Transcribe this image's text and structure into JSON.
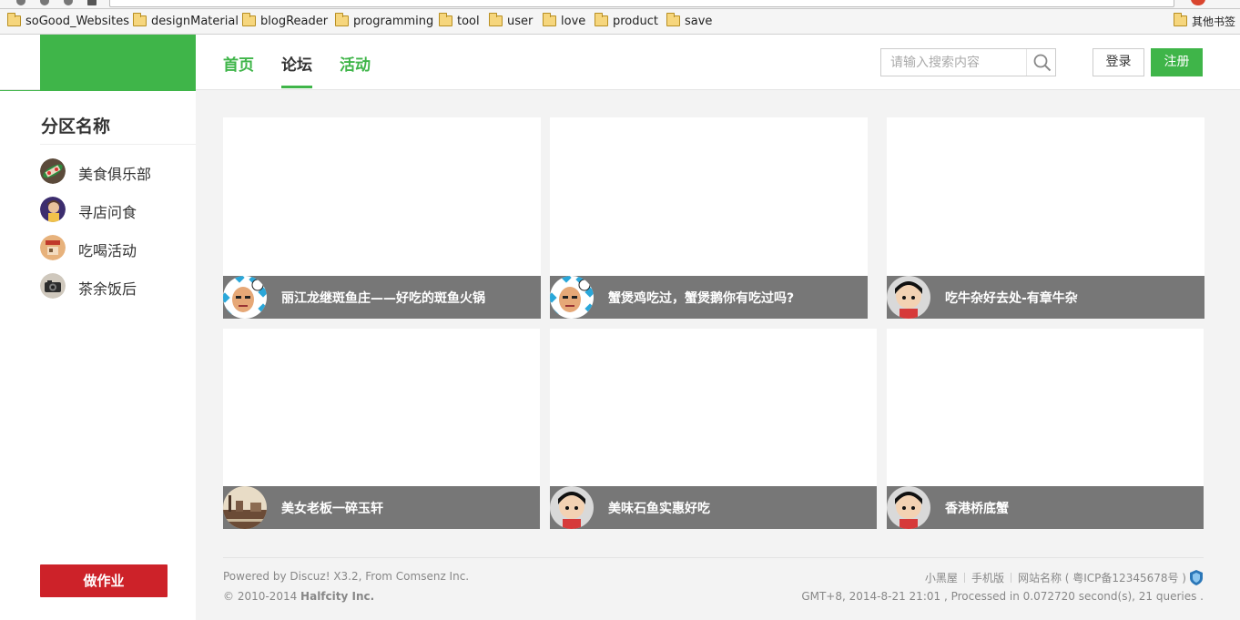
{
  "bookmarks": [
    {
      "label": "soGood_Websites"
    },
    {
      "label": "designMaterial"
    },
    {
      "label": "blogReader"
    },
    {
      "label": "programming"
    },
    {
      "label": "tool"
    },
    {
      "label": "user"
    },
    {
      "label": "love"
    },
    {
      "label": "product"
    },
    {
      "label": "save"
    }
  ],
  "other_bookmarks": "其他书签",
  "nav": {
    "items": [
      {
        "label": "首页"
      },
      {
        "label": "论坛"
      },
      {
        "label": "活动"
      }
    ],
    "active": "论坛"
  },
  "search": {
    "placeholder": "请输入搜索内容"
  },
  "auth": {
    "login": "登录",
    "register": "注册"
  },
  "sidebar": {
    "title": "分区名称",
    "items": [
      {
        "label": "美食俱乐部",
        "icon": "food-avatar"
      },
      {
        "label": "寻店问食",
        "icon": "person-avatar"
      },
      {
        "label": "吃喝活动",
        "icon": "poster-avatar"
      },
      {
        "label": "茶余饭后",
        "icon": "camera-avatar"
      }
    ],
    "action": "做作业"
  },
  "threads": [
    {
      "title": "丽江龙继斑鱼庄——好吃的斑鱼火锅",
      "avatar": "bald-man-avatar"
    },
    {
      "title": "蟹煲鸡吃过，蟹煲鹅你有吃过吗?",
      "avatar": "bald-man-avatar"
    },
    {
      "title": "吃牛杂好去处-有章牛杂",
      "avatar": "girl-avatar"
    },
    {
      "title": "美女老板一碎玉轩",
      "avatar": "city-photo-avatar"
    },
    {
      "title": "美味石鱼实惠好吃",
      "avatar": "girl-avatar"
    },
    {
      "title": "香港桥底蟹",
      "avatar": "girl-avatar"
    }
  ],
  "footer": {
    "powered_prefix": "Powered by Discuz! X3.2, From Comsenz Inc.",
    "copyright_prefix": "© 2010-2014 ",
    "copyright_company": "Halfcity Inc.",
    "links": [
      "小黑屋",
      "手机版",
      "网站名称 ( 粤ICP备12345678号 )"
    ],
    "stats": "GMT+8, 2014-8-21 21:01 , Processed in 0.072720 second(s), 21 queries ."
  },
  "colors": {
    "brand": "#3fb549",
    "danger": "#cd2229",
    "card_bar": "#777777"
  }
}
